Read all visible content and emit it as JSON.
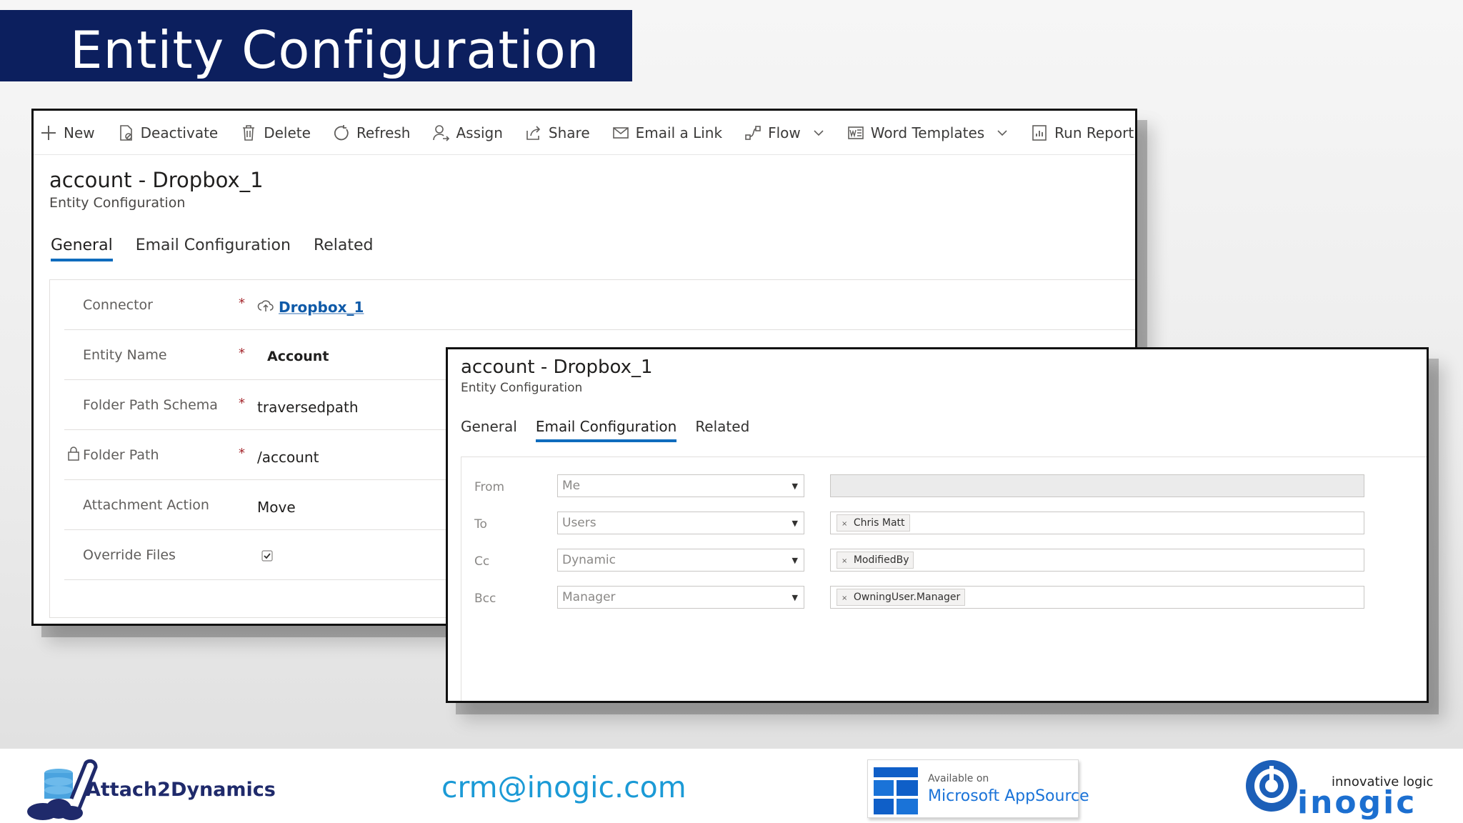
{
  "banner": {
    "title": "Entity Configuration"
  },
  "command_bar": {
    "items": [
      {
        "label": "New",
        "icon": "plus-icon"
      },
      {
        "label": "Deactivate",
        "icon": "deactivate-icon"
      },
      {
        "label": "Delete",
        "icon": "trash-icon"
      },
      {
        "label": "Refresh",
        "icon": "refresh-icon"
      },
      {
        "label": "Assign",
        "icon": "assign-icon"
      },
      {
        "label": "Share",
        "icon": "share-icon"
      },
      {
        "label": "Email a Link",
        "icon": "email-icon"
      },
      {
        "label": "Flow",
        "icon": "flow-icon",
        "dropdown": true
      },
      {
        "label": "Word Templates",
        "icon": "word-icon",
        "dropdown": true
      },
      {
        "label": "Run Report",
        "icon": "report-icon",
        "dropdown": true
      }
    ]
  },
  "record": {
    "title": "account - Dropbox_1",
    "subtitle": "Entity Configuration",
    "tabs": [
      "General",
      "Email Configuration",
      "Related"
    ]
  },
  "general_form": {
    "rows": [
      {
        "label": "Connector",
        "required": "*",
        "value": "Dropbox_1"
      },
      {
        "label": "Entity Name",
        "required": "*",
        "value": "Account"
      },
      {
        "label": "Folder Path Schema",
        "required": "*",
        "value": "traversedpath"
      },
      {
        "label": "Folder Path",
        "required": "*",
        "value": "/account"
      },
      {
        "label": "Attachment Action",
        "required": "",
        "value": "Move"
      },
      {
        "label": "Override Files",
        "required": "",
        "checked": true
      }
    ]
  },
  "email_form": {
    "rows": [
      {
        "label": "From",
        "type": "Me",
        "recipient": ""
      },
      {
        "label": "To",
        "type": "Users",
        "recipient": "Chris Matt"
      },
      {
        "label": "Cc",
        "type": "Dynamic",
        "recipient": "ModifiedBy"
      },
      {
        "label": "Bcc",
        "type": "Manager",
        "recipient": "OwningUser.Manager"
      }
    ],
    "chip_remove": "×",
    "select_arrow": "▼"
  },
  "footer": {
    "product": "Attach2Dynamics",
    "email": "crm@inogic.com",
    "appsource_available": "Available on",
    "appsource_name": "Microsoft AppSource",
    "company_tagline": "innovative logic",
    "company_name": "inogic"
  },
  "colors": {
    "banner": "#0c1f5e",
    "tab_underline": "#0f6cbd",
    "link": "#0f5aa8",
    "email": "#1b9ad6"
  }
}
